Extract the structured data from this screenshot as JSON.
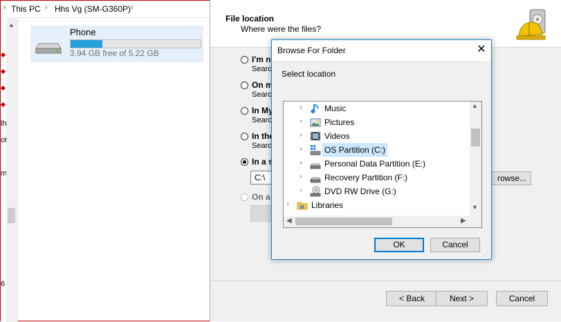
{
  "explorer": {
    "breadcrumb": [
      "This PC",
      "Hhs Vg (SM-G360P)"
    ],
    "left_fragments": [
      "lh",
      "ot",
      "m",
      "6"
    ],
    "device": {
      "name": "Phone",
      "free_text": "3.94 GB free of 5.22 GB",
      "used_fraction": 0.245
    }
  },
  "wizard": {
    "title": "File location",
    "subtitle": "Where were the files?",
    "options": [
      {
        "label": "I'm n",
        "desc": "Search",
        "selected": false,
        "enabled": true
      },
      {
        "label": "On m",
        "desc": "Search",
        "selected": false,
        "enabled": true
      },
      {
        "label": "In My",
        "desc": "Search",
        "selected": false,
        "enabled": true
      },
      {
        "label": "In the",
        "desc": "Search",
        "selected": false,
        "enabled": true
      },
      {
        "label": "In a s",
        "desc": "",
        "selected": true,
        "enabled": true
      },
      {
        "label": "On a",
        "desc": "",
        "selected": false,
        "enabled": false
      }
    ],
    "path_value": "C:\\",
    "browse_label": "rowse...",
    "back_label": "< Back",
    "next_label": "Next >",
    "cancel_label": "Cancel"
  },
  "dialog": {
    "title": "Browse For Folder",
    "close_glyph": "✕",
    "prompt": "Select location",
    "tree": [
      {
        "label": "Music",
        "icon": "music-icon",
        "selected": false
      },
      {
        "label": "Pictures",
        "icon": "pictures-icon",
        "selected": false
      },
      {
        "label": "Videos",
        "icon": "videos-icon",
        "selected": false
      },
      {
        "label": "OS Partition (C:)",
        "icon": "os-drive-icon",
        "selected": true
      },
      {
        "label": "Personal Data Partition (E:)",
        "icon": "drive-icon",
        "selected": false
      },
      {
        "label": "Recovery Partition (F:)",
        "icon": "drive-icon",
        "selected": false
      },
      {
        "label": "DVD RW Drive (G:)",
        "icon": "dvd-drive-icon",
        "selected": false
      },
      {
        "label": "Libraries",
        "icon": "libraries-icon",
        "selected": false
      }
    ],
    "ok_label": "OK",
    "cancel_label": "Cancel"
  },
  "colors": {
    "selection": "#cce8ff",
    "accent": "#0078d7",
    "progress": "#26a0da",
    "annotation_red": "#c00000"
  }
}
